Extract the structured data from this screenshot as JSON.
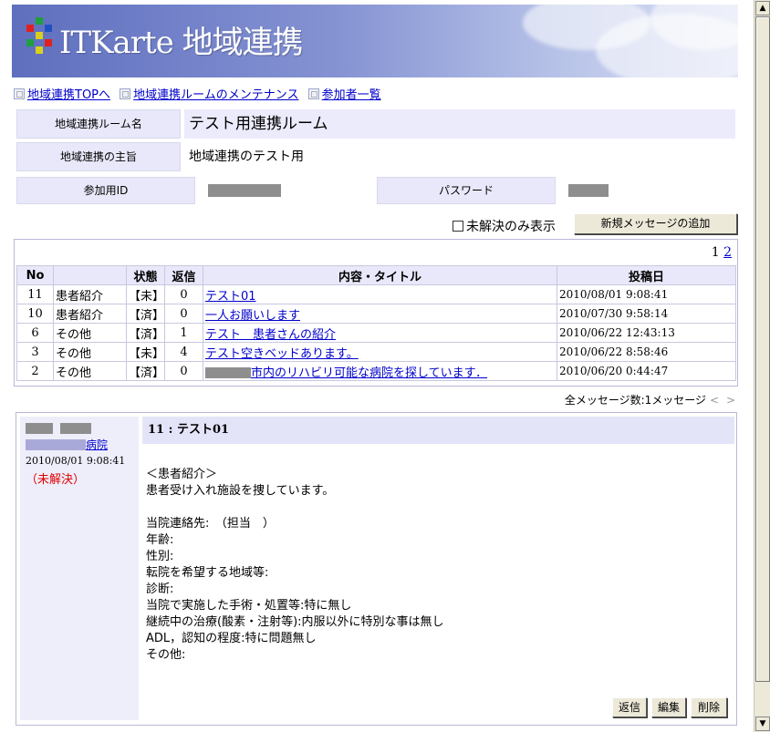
{
  "banner": {
    "title": "ITKarte 地域連携"
  },
  "topnav": [
    {
      "label": "地域連携TOPへ"
    },
    {
      "label": "地域連携ルームのメンテナンス"
    },
    {
      "label": "参加者一覧"
    }
  ],
  "room": {
    "name_label": "地域連携ルーム名",
    "name_value": "テスト用連携ルーム",
    "purpose_label": "地域連携の主旨",
    "purpose_value": "地域連携のテスト用",
    "id_label": "参加用ID",
    "password_label": "パスワード"
  },
  "filter": {
    "unresolved_only_label": "未解決のみ表示",
    "unresolved_only_checked": false
  },
  "buttons": {
    "add_message": "新規メッセージの追加",
    "reply": "返信",
    "edit": "編集",
    "delete": "削除"
  },
  "pager": {
    "current": "1",
    "next": "2"
  },
  "list": {
    "headers": {
      "no": "No",
      "category": "",
      "status": "状態",
      "replies": "返信",
      "title": "内容・タイトル",
      "posted": "投稿日"
    },
    "rows": [
      {
        "no": "11",
        "category": "患者紹介",
        "status": "【未】",
        "replies": "0",
        "title": "テスト01",
        "posted": "2010/08/01 9:08:41"
      },
      {
        "no": "10",
        "category": "患者紹介",
        "status": "【済】",
        "replies": "0",
        "title": "一人お願いします",
        "posted": "2010/07/30 9:58:14"
      },
      {
        "no": "6",
        "category": "その他",
        "status": "【済】",
        "replies": "1",
        "title": "テスト　患者さんの紹介",
        "posted": "2010/06/22 12:43:13"
      },
      {
        "no": "3",
        "category": "その他",
        "status": "【未】",
        "replies": "4",
        "title": "テスト空きベッドあります。",
        "posted": "2010/06/22 8:58:46"
      },
      {
        "no": "2",
        "category": "その他",
        "status": "【済】",
        "replies": "0",
        "title": "市内のリハビリ可能な病院を探しています．",
        "posted": "2010/06/20 0:44:47"
      }
    ]
  },
  "total": {
    "text": "全メッセージ数:1メッセージ",
    "prev": "<",
    "next": ">"
  },
  "message": {
    "author_inst_suffix": "病院",
    "date": "2010/08/01 9:08:41",
    "status": "（未解決）",
    "title": "11 : テスト01",
    "body": "＜患者紹介＞\n患者受け入れ施設を捜しています。\n\n当院連絡先:　（担当　）\n年齢:\n性別:\n転院を希望する地域等:\n診断:\n当院で実施した手術・処置等:特に無し\n継続中の治療(酸素・注射等):内服以外に特別な事は無し\nADL，認知の程度:特に問題無し\nその他:"
  },
  "colors": {
    "link": "#0000cc",
    "header_bg": "#e8e8fa",
    "status_red": "#e00000"
  }
}
